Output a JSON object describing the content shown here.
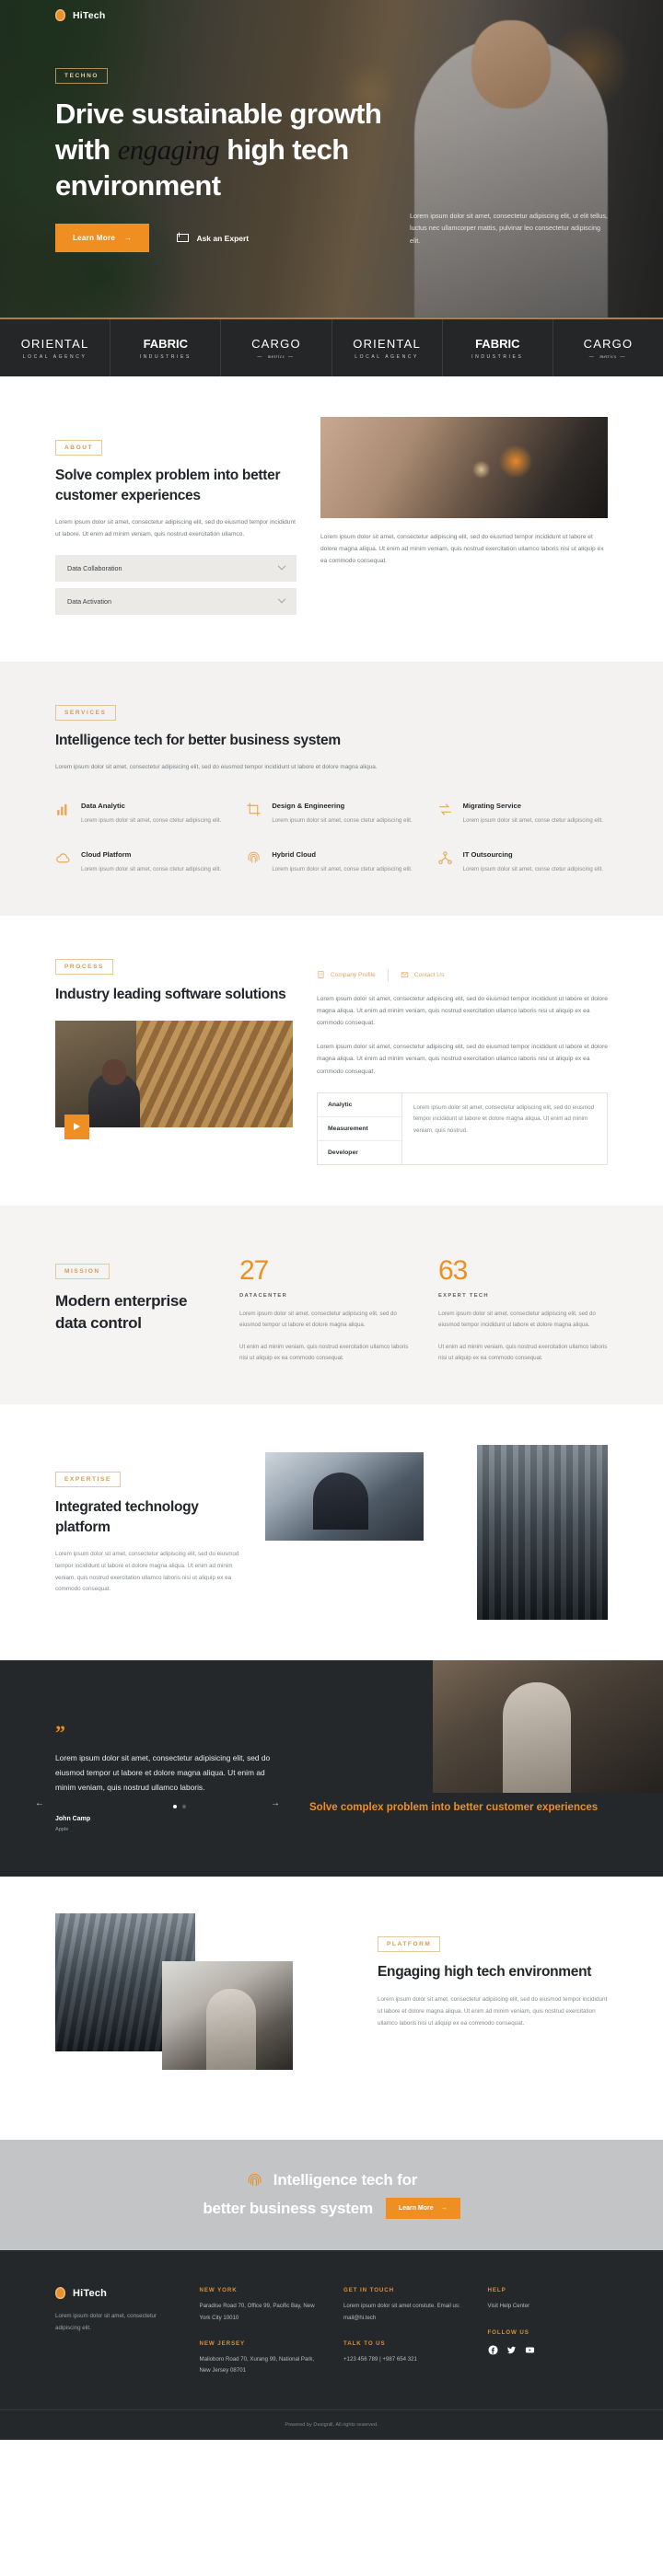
{
  "brand": {
    "name": "HiTech",
    "logo_icon": "fingerprint-icon"
  },
  "hero": {
    "badge": "TECHNO",
    "title_part1": "Drive sustainable growth",
    "title_part2_a": "with ",
    "title_part2_em": "engaging",
    "title_part2_b": " high tech",
    "title_part3": "environment",
    "primary_cta": "Learn More",
    "primary_cta_arrow": "→",
    "secondary_cta": "Ask an Expert",
    "secondary_icon": "envelope-icon",
    "note": "Lorem ipsum dolor sit amet, consectetur adipiscing elit, ut elit tellus, luctus nec ullamcorper mattis, pulvinar leo consectetur adipiscing elit."
  },
  "logos": [
    {
      "name": "ORIENTAL",
      "sub": "LOCAL AGENCY",
      "bold": false
    },
    {
      "name": "FABRIC",
      "sub": "INDUSTRIES",
      "bold": true
    },
    {
      "name": "CARGO",
      "sub": "metrics",
      "bold": false
    },
    {
      "name": "ORIENTAL",
      "sub": "LOCAL AGENCY",
      "bold": false
    },
    {
      "name": "FABRIC",
      "sub": "INDUSTRIES",
      "bold": true
    },
    {
      "name": "CARGO",
      "sub": "metrics",
      "bold": false
    }
  ],
  "about": {
    "badge": "ABOUT",
    "title": "Solve complex problem into better customer experiences",
    "text": "Lorem ipsum dolor sit amet, consectetur adipiscing elit, sed do eiusmod tempor incididunt ut labore. Ut enim ad minim veniam, quis nostrud exercitation ullamco.",
    "accordion": [
      {
        "label": "Data Collaboration",
        "icon": "chevron-down-icon"
      },
      {
        "label": "Data Activation",
        "icon": "chevron-down-icon"
      }
    ],
    "right_text": "Lorem ipsum dolor sit amet, consectetur adipiscing elit, sed do eiusmod tempor incididunt ut labore et dolore magna aliqua. Ut enim ad minim veniam, quis nostrud exercitation ullamco laboris nisi ut aliquip ex ea commodo consequat."
  },
  "services": {
    "badge": "SERVICES",
    "title": "Intelligence tech for better business system",
    "subtitle": "Lorem ipsum dolor sit amet, consectetur adipisicing elit, sed do eiusmod tempor incididunt ut labore et dolore magna aliqua.",
    "items": [
      {
        "name": "Data Analytic",
        "icon": "bar-chart-icon",
        "text": "Lorem ipsum dolor sit amet, conse ctetur adipiscing elit."
      },
      {
        "name": "Design & Engineering",
        "icon": "crop-icon",
        "text": "Lorem ipsum dolor sit amet, conse ctetur adipiscing elit."
      },
      {
        "name": "Migrating Service",
        "icon": "exchange-icon",
        "text": "Lorem ipsum dolor sit amet, conse ctetur adipiscing elit."
      },
      {
        "name": "Cloud Platform",
        "icon": "cloud-icon",
        "text": "Lorem ipsum dolor sit amet, conse ctetur adipiscing elit."
      },
      {
        "name": "Hybrid Cloud",
        "icon": "fingerprint-icon",
        "text": "Lorem ipsum dolor sit amet, conse ctetur adipiscing elit."
      },
      {
        "name": "IT Outsourcing",
        "icon": "network-icon",
        "text": "Lorem ipsum dolor sit amet, conse ctetur adipiscing elit."
      }
    ]
  },
  "process": {
    "badge": "PROCESS",
    "title": "Industry leading software solutions",
    "play_icon": "play-icon",
    "tabs": [
      {
        "label": "Company Profile",
        "icon": "building-icon",
        "active": true
      },
      {
        "label": "Contact Us",
        "icon": "envelope-icon",
        "active": false
      }
    ],
    "paragraph1": "Lorem ipsum dolor sit amet, consectetur adipiscing elit, sed do eiusmod tempor incididunt ut labore et dolore magna aliqua. Ut enim ad minim veniam, quis nostrud exercitation ullamco laboris nisi ut aliquip ex ea commodo consequat.",
    "paragraph2": "Lorem ipsum dolor sit amet, consectetur adipiscing elit, sed do eiusmod tempor incididunt ut labore et dolore magna aliqua. Ut enim ad minim veniam, quis nostrud exercitation ullamco laboris nisi ut aliquip ex ea commodo consequat.",
    "table_rows": [
      "Analytic",
      "Measurement",
      "Developer"
    ],
    "table_body": "Lorem ipsum dolor sit amet, consectetur adipiscing elit, sed do eiusmod tempor incididunt ut labore et dolore magna aliqua. Ut enim ad minim veniam, quis nostrud."
  },
  "mission": {
    "badge": "MISSION",
    "title": "Modern enterprise data control",
    "stats": [
      {
        "value": "27",
        "label": "DATACENTER",
        "text1": "Lorem ipsum dolor sit amet, consectetur adipiscing elit, sed do eiusmod tempor ut labore et dolore magna aliqua.",
        "text2": "Ut enim ad minim veniam, quis nostrud exercitation ullamco laboris nisi ut aliquip ex ea commodo consequat."
      },
      {
        "value": "63",
        "label": "EXPERT TECH",
        "text1": "Lorem ipsum dolor sit amet, consectetur adipiscing elit, sed do eiusmod tempor incididunt ut labore et dolore magna aliqua.",
        "text2": "Ut enim ad minim veniam, quis nostrud exercitation ullamco laboris nisi ut aliquip ex ea commodo consequat."
      }
    ]
  },
  "expertise": {
    "badge": "EXPERTISE",
    "title": "Integrated technology platform",
    "text": "Lorem ipsum dolor sit amet, consectetur adipiscing elit, sed do eiusmod tempor incididunt ut labore et dolore magna aliqua. Ut enim ad minim veniam, quis nostrud exercitation ullamco laboris nisi ut aliquip ex ea commodo consequat."
  },
  "testimonial": {
    "quote_icon": "quote-icon",
    "text": "Lorem ipsum dolor sit amet, consectetur adipisicing elit, sed do eiusmod tempor ut labore et dolore magna aliqua. Ut enim ad minim veniam, quis nostrud ullamco laboris.",
    "author": "John Camp",
    "role": "Apple",
    "prev_icon": "arrow-left-icon",
    "next_icon": "arrow-right-icon",
    "heading": "Solve complex problem into better customer experiences"
  },
  "platform": {
    "badge": "PLATFORM",
    "title": "Engaging high tech environment",
    "text": "Lorem ipsum dolor sit amet, consectetur adipiscing elit, sed do eiusmod tempor incididunt ut labore et dolore magna aliqua. Ut enim ad minim veniam, quis nostrud exercitation ullamco laboris nisi ut aliquip ex ea commodo consequat."
  },
  "cta_band": {
    "icon": "fingerprint-icon",
    "line1": "Intelligence tech for",
    "line2": "better business system",
    "button": "Learn More",
    "button_arrow": "→"
  },
  "footer": {
    "brand": "HiTech",
    "tagline": "Lorem ipsum dolor sit amet, consectetur adipiscing elit.",
    "col1": [
      {
        "heading": "NEW YORK",
        "text": "Paradise Road 70, Office 99, Pacific Bay,  New York City 10010"
      },
      {
        "heading": "NEW JERSEY",
        "text": "Malioboro Road 70, Xurang 99, National Park, New Jersey 08701"
      }
    ],
    "col2": [
      {
        "heading": "GET IN TOUCH",
        "text": "Lorem ipsum dolor sit amet constute. Email us: mail@hi.tech"
      },
      {
        "heading": "TALK TO US",
        "text": "+123 456 789 | +987 654 321"
      }
    ],
    "col3": [
      {
        "heading": "HELP",
        "text": "Visit Help Center"
      },
      {
        "heading": "FOLLOW US",
        "text": ""
      }
    ],
    "social": [
      "facebook-icon",
      "twitter-icon",
      "youtube-icon"
    ],
    "copyright": "Powered by Designill. All rights reserved."
  },
  "colors": {
    "accent": "#ef8f22",
    "dark": "#24282a",
    "band": "#c2c4c6",
    "muted": "#868b8f"
  }
}
